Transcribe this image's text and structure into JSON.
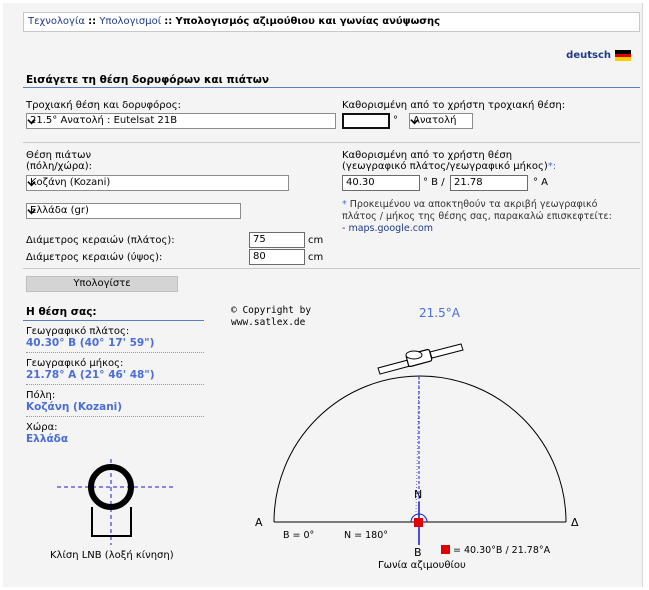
{
  "breadcrumb": {
    "item1": "Τεχνολογία",
    "sep": "::",
    "item2": "Υπολογισμοί",
    "current": "Υπολογισμός αζιμούθιου και γωνίας ανύψωσης"
  },
  "language_link": "deutsch",
  "section_title": "Εισάγετε τη θέση δορυφόρων και πιάτων",
  "orbital": {
    "label": "Τροχιακή θέση και δορυφόρος:",
    "value": "21.5° Ανατολή : Eutelsat 21B",
    "custom_label": "Καθορισμένη από το χρήστη τροχιακή θέση:",
    "custom_value": "",
    "degree_unit": "°",
    "direction_value": "Ανατολή"
  },
  "dish": {
    "label_line1": "Θέση πιάτων",
    "label_line2": "(πόλη/χώρα):",
    "city_value": "Κοζάνη (Kozani)",
    "country_value": "Ελλάδα (gr)",
    "custom_label_line1": "Καθορισμένη από το χρήστη θέση",
    "custom_label_line2": "(γεωγραφικό πλάτος/γεωγραφικό μήκος)",
    "custom_label_star": "*:",
    "lat_value": "40.30",
    "lat_unit": "° Β /",
    "lon_value": "21.78",
    "lon_unit": "° Α"
  },
  "note": {
    "star": "*",
    "text": " Προκειμένου να αποκτηθούν τα ακριβή γεωγραφικό πλάτος / μήκος της θέσης σας, παρακαλώ επισκεφτείτε:",
    "prefix": "- ",
    "link": "maps.google.com"
  },
  "antenna": {
    "width_label": "Διάμετρος κεραιών (πλάτος):",
    "width_value": "75",
    "height_label": "Διάμετρος κεραιών (ύψος):",
    "height_value": "80",
    "unit": "cm"
  },
  "calculate_button": "Υπολογίστε",
  "results": {
    "heading": "Η θέση σας:",
    "lat_label": "Γεωγραφικό πλάτος:",
    "lat_value": "40.30° Β (40° 17' 59\")",
    "lon_label": "Γεωγραφικό μήκος:",
    "lon_value": "21.78° Α (21° 46' 48\")",
    "city_label": "Πόλη:",
    "city_value": "Κοζάνη (Kozani)",
    "country_label": "Χώρα:",
    "country_value": "Ελλάδα"
  },
  "copyright": {
    "line1": "© Copyright by",
    "line2": "www.satlex.de"
  },
  "lnb_caption": "Κλίση LNB (λοξή κίνηση)",
  "diagram": {
    "sat_label": "21.5°A",
    "west": "Α",
    "east": "Δ",
    "north": "N",
    "south": "B",
    "west_deg": "B = 0°",
    "north_deg": "N = 180°",
    "legend": "= 40.30°B / 21.78°A",
    "caption": "Γωνία αζιμουθίου"
  },
  "colors": {
    "accent_blue": "#4a6ed8",
    "marker_red": "#e00000",
    "link": "#1f3a8a"
  }
}
